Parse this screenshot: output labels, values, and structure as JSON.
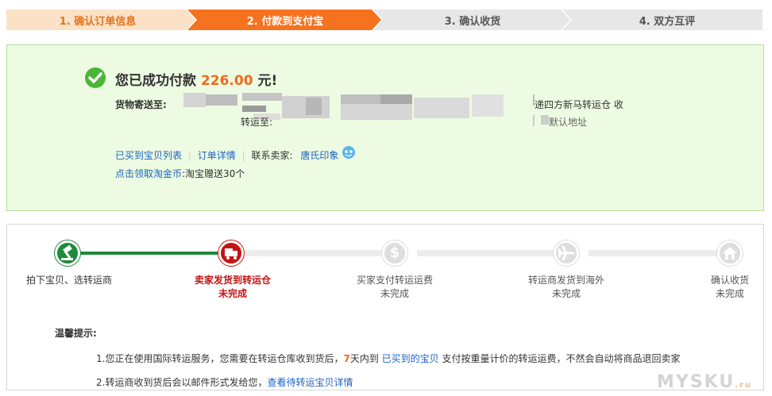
{
  "steps": [
    {
      "label": "1. 确认订单信息",
      "state": "done"
    },
    {
      "label": "2. 付款到支付宝",
      "state": "active"
    },
    {
      "label": "3. 确认收货",
      "state": "todo"
    },
    {
      "label": "4. 双方互评",
      "state": "todo"
    }
  ],
  "success": {
    "title_prefix": "您已成功付款",
    "amount": "226.00",
    "title_suffix": "元!",
    "ship_label": "货物寄送至:",
    "ship_right": "递四方新马转运仓 收",
    "relay_label": "转运至:",
    "default_addr": "默认地址",
    "link_bought": "已买到宝贝列表",
    "link_order": "订单详情",
    "contact_label": "联系卖家:",
    "seller_name": "唐氏印象",
    "coin_link": "点击领取淘金币",
    "coin_text": ":淘宝赠送30个"
  },
  "progress": {
    "stages": [
      {
        "title": "拍下宝贝、选转运商",
        "status": "",
        "icon": "hammer-icon",
        "state": "done"
      },
      {
        "title": "卖家发货到转运仓",
        "status": "未完成",
        "icon": "truck-icon",
        "state": "current"
      },
      {
        "title": "买家支付转运运费",
        "status": "未完成",
        "icon": "dollar-icon",
        "state": "todo"
      },
      {
        "title": "转运商发货到海外",
        "status": "未完成",
        "icon": "plane-icon",
        "state": "todo"
      },
      {
        "title": "确认收货",
        "status": "未完成",
        "icon": "house-icon",
        "state": "todo"
      }
    ]
  },
  "tips": {
    "title": "温馨提示:",
    "t1_a": "1.您正在使用国际转运服务，您需要在转运仓库收到货后，",
    "t1_days": "7",
    "t1_b": "天内到",
    "t1_link": "已买到的宝贝",
    "t1_c": "支付按重量计价的转运运费，不然会自动将商品退回卖家",
    "t2_a": "2.转运商收到货后会以邮件形式发给您，",
    "t2_link": "查看待转运宝贝详情"
  },
  "watermark": "MYSKU",
  "watermark_suffix": ".ru",
  "colors": {
    "active": "#f6721f",
    "done_bg": "#fbe1c6",
    "success": "#4bb536",
    "amount": "#f06a1b",
    "current": "#c41414"
  }
}
